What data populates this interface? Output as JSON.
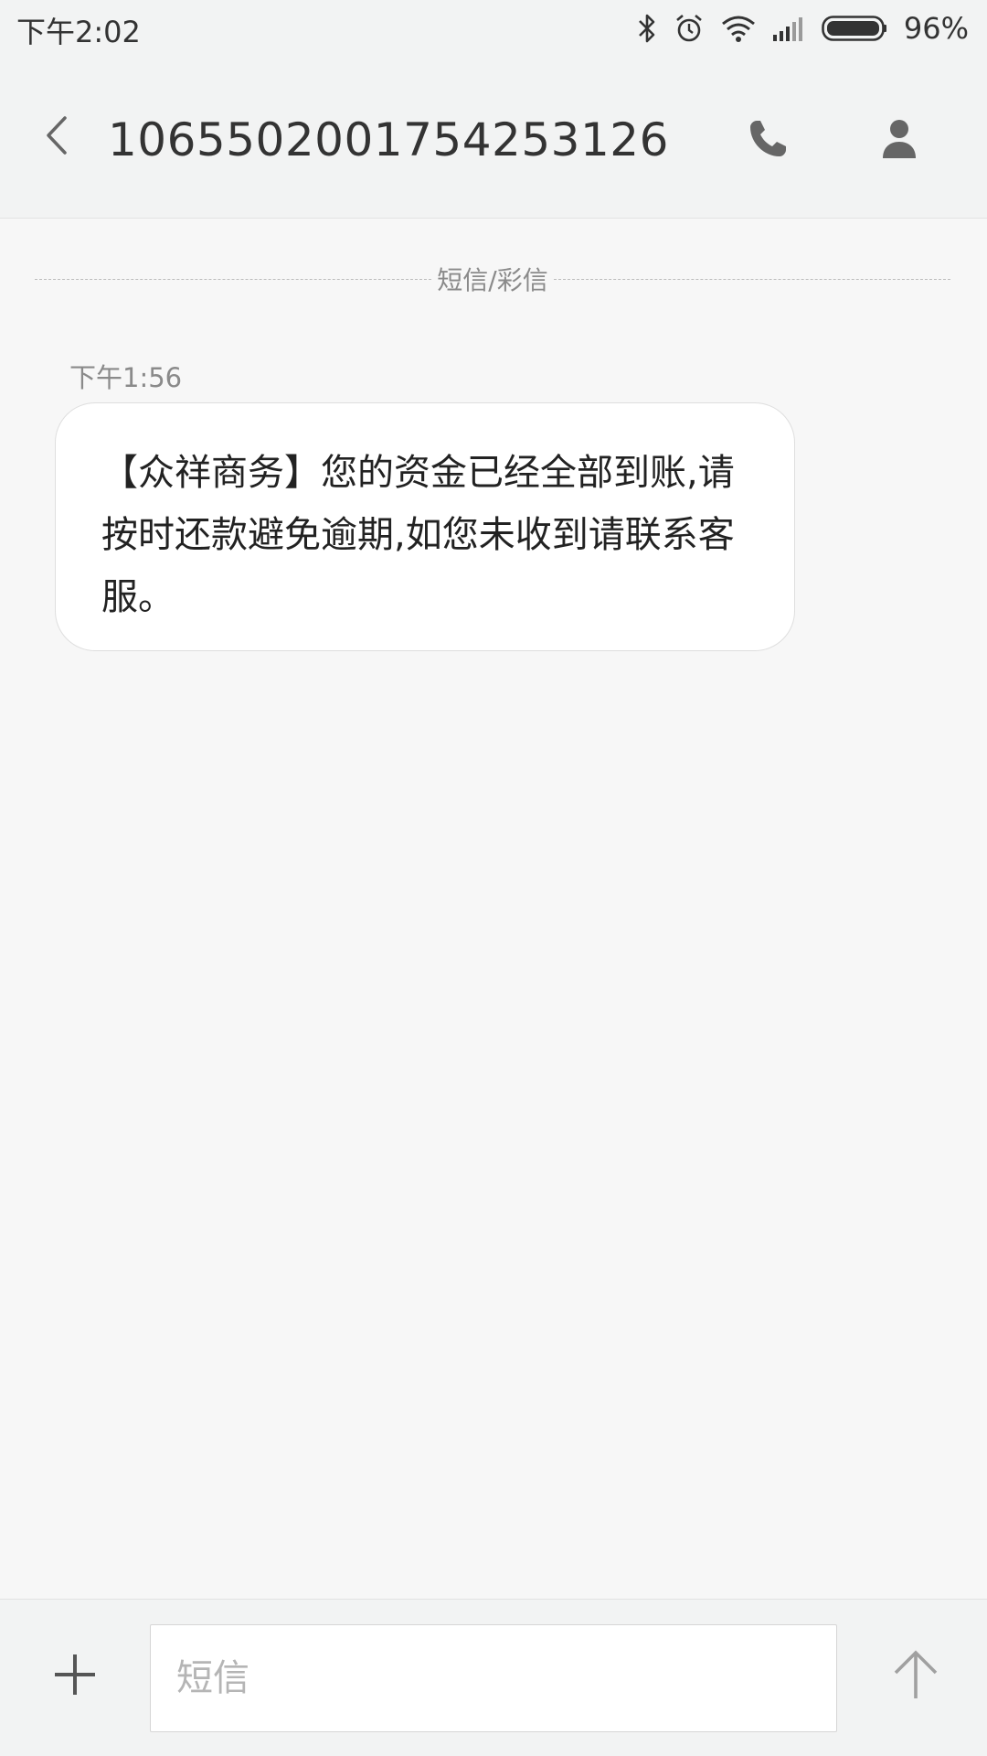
{
  "status_bar": {
    "time": "下午2:02",
    "battery_percent": "96%",
    "icons": [
      "bluetooth-icon",
      "alarm-icon",
      "wifi-icon",
      "signal-icon",
      "battery-icon"
    ]
  },
  "header": {
    "title": "1065502001754253126",
    "icons": [
      "back-arrow-icon",
      "phone-icon",
      "person-icon"
    ]
  },
  "thread": {
    "divider_label": "短信/彩信",
    "messages": [
      {
        "time": "下午1:56",
        "text": "【众祥商务】您的资金已经全部到账,请按时还款避免逾期,如您未收到请联系客服。"
      }
    ]
  },
  "compose": {
    "placeholder": "短信",
    "value": "",
    "icons": [
      "plus-icon",
      "send-arrow-icon"
    ]
  },
  "colors": {
    "background": "#f7f7f7",
    "bar": "#f2f3f3",
    "bubble": "#ffffff",
    "text": "#222222",
    "muted": "#8a8a8a",
    "icon": "#555555"
  }
}
